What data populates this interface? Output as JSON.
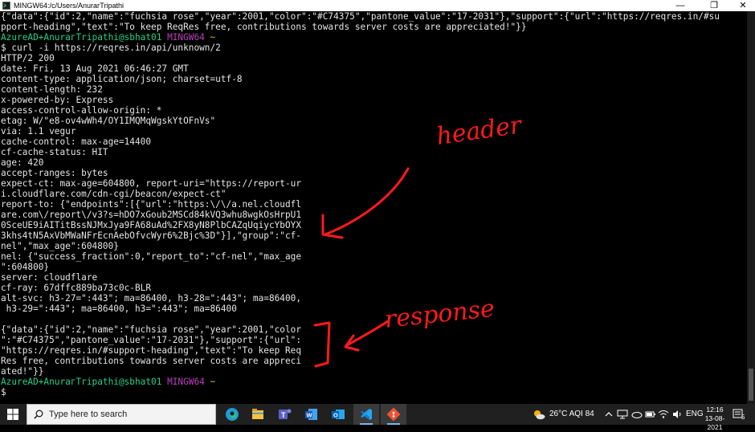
{
  "window": {
    "title": "MINGW64:/c/Users/AnurагTripathi",
    "controls": {
      "minimize": "—",
      "maximize": "❐",
      "close": "✕"
    }
  },
  "terminal": {
    "lines": [
      [
        {
          "t": "{\"data\":{\"id\":2,\"name\":\"fuchsia rose\",\"year\":2001,\"color\":\"#C74375\",\"pantone_value\":\"17-2031\"},\"support\":{\"url\":\"https://reqres.in/#su",
          "c": ""
        }
      ],
      [
        {
          "t": "pport-heading\",\"text\":\"To keep ReqRes free, contributions towards server costs are appreciated!\"}}",
          "c": ""
        }
      ],
      [
        {
          "t": "AzureAD+AnurагTripathi@sbhat01 ",
          "c": "g"
        },
        {
          "t": "MINGW64 ",
          "c": "m"
        },
        {
          "t": "~",
          "c": "y"
        }
      ],
      [
        {
          "t": "$ curl -i https://reqres.in/api/unknown/2",
          "c": ""
        }
      ],
      [
        {
          "t": "HTTP/2 200",
          "c": ""
        }
      ],
      [
        {
          "t": "date: Fri, 13 Aug 2021 06:46:27 GMT",
          "c": ""
        }
      ],
      [
        {
          "t": "content-type: application/json; charset=utf-8",
          "c": ""
        }
      ],
      [
        {
          "t": "content-length: 232",
          "c": ""
        }
      ],
      [
        {
          "t": "x-powered-by: Express",
          "c": ""
        }
      ],
      [
        {
          "t": "access-control-allow-origin: *",
          "c": ""
        }
      ],
      [
        {
          "t": "etag: W/\"e8-ov4wWh4/OY1IMQMqWgskYtOFnVs\"",
          "c": ""
        }
      ],
      [
        {
          "t": "via: 1.1 vegur",
          "c": ""
        }
      ],
      [
        {
          "t": "cache-control: max-age=14400",
          "c": ""
        }
      ],
      [
        {
          "t": "cf-cache-status: HIT",
          "c": ""
        }
      ],
      [
        {
          "t": "age: 420",
          "c": ""
        }
      ],
      [
        {
          "t": "accept-ranges: bytes",
          "c": ""
        }
      ],
      [
        {
          "t": "expect-ct: max-age=604800, report-uri=\"https://report-ur",
          "c": ""
        }
      ],
      [
        {
          "t": "i.cloudflare.com/cdn-cgi/beacon/expect-ct\"",
          "c": ""
        }
      ],
      [
        {
          "t": "report-to: {\"endpoints\":[{\"url\":\"https:\\/\\/a.nel.cloudfl",
          "c": ""
        }
      ],
      [
        {
          "t": "are.com\\/report\\/v3?s=hDO7xGoub2MSCd84kVQ3whu8wgkOsHrpU1",
          "c": ""
        }
      ],
      [
        {
          "t": "0SceUE9iAITitBssNJMxJya9FA68uAd%2FX8yN8PlbCAZqUqiycYbOYX",
          "c": ""
        }
      ],
      [
        {
          "t": "3khs4tN5AxVbMWaNFrEcnAebOfvcWyr6%2Bjc%3D\"}],\"group\":\"cf-",
          "c": ""
        }
      ],
      [
        {
          "t": "nel\",\"max_age\":604800}",
          "c": ""
        }
      ],
      [
        {
          "t": "nel: {\"success_fraction\":0,\"report_to\":\"cf-nel\",\"max_age",
          "c": ""
        }
      ],
      [
        {
          "t": "\":604800}",
          "c": ""
        }
      ],
      [
        {
          "t": "server: cloudflare",
          "c": ""
        }
      ],
      [
        {
          "t": "cf-ray: 67dffc889ba73c0c-BLR",
          "c": ""
        }
      ],
      [
        {
          "t": "alt-svc: h3-27=\":443\"; ma=86400, h3-28=\":443\"; ma=86400,",
          "c": ""
        }
      ],
      [
        {
          "t": " h3-29=\":443\"; ma=86400, h3=\":443\"; ma=86400",
          "c": ""
        }
      ],
      [
        {
          "t": "",
          "c": ""
        }
      ],
      [
        {
          "t": "{\"data\":{\"id\":2,\"name\":\"fuchsia rose\",\"year\":2001,\"color",
          "c": ""
        }
      ],
      [
        {
          "t": "\":\"#C74375\",\"pantone_value\":\"17-2031\"},\"support\":{\"url\":",
          "c": ""
        }
      ],
      [
        {
          "t": "\"https://reqres.in/#support-heading\",\"text\":\"To keep Req",
          "c": ""
        }
      ],
      [
        {
          "t": "Res free, contributions towards server costs are appreci",
          "c": ""
        }
      ],
      [
        {
          "t": "ated!\"}}",
          "c": ""
        }
      ],
      [
        {
          "t": "AzureAD+AnurагTripathi@sbhat01 ",
          "c": "g"
        },
        {
          "t": "MINGW64 ",
          "c": "m"
        },
        {
          "t": "~",
          "c": "y"
        }
      ],
      [
        {
          "t": "$",
          "c": ""
        }
      ]
    ]
  },
  "annotations": {
    "header_label": "header",
    "response_label": "response",
    "color": "#ff1a1a"
  },
  "taskbar": {
    "search_placeholder": "Type here to search",
    "apps": [
      "edge-icon",
      "file-explorer-icon",
      "teams-icon",
      "word-icon",
      "outlook-icon",
      "vscode-icon",
      "git-bash-icon"
    ],
    "weather": "26°C  AQI 84",
    "language": "ENG",
    "time": "12:16",
    "date": "13-08-2021",
    "notification_count": "5"
  }
}
